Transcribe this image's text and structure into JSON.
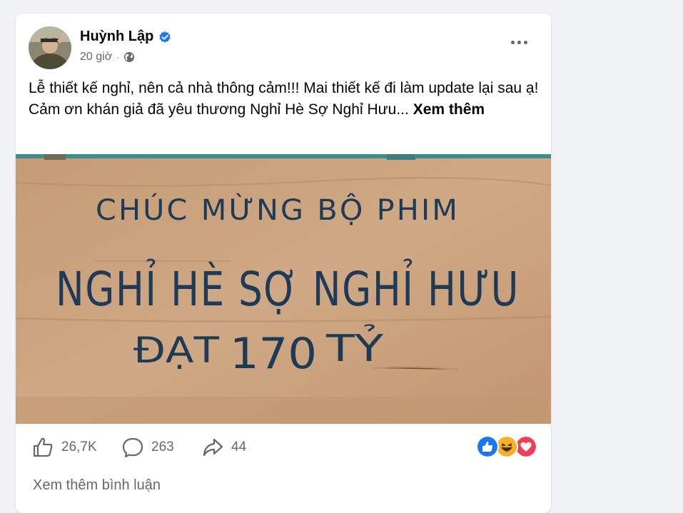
{
  "post": {
    "author": "Huỳnh Lập",
    "time": "20 giờ",
    "separator": "·",
    "text_line1": "Lễ thiết kế nghỉ, nên cả nhà thông cảm!!! Mai thiết kế đi làm update lại sau ạ!",
    "text_line2": "Cảm ơn khán giả đã yêu thương Nghỉ Hè Sợ Nghỉ Hưu...",
    "see_more": "Xem thêm"
  },
  "photo": {
    "line1": "CHÚC MỪNG BỘ PHIM",
    "line2": "NGHỈ HÈ SỢ NGHỈ HƯU",
    "line3_prefix": "ĐẠT",
    "line3_number": "170",
    "line3_suffix": "TỶ"
  },
  "stats": {
    "likes": "26,7K",
    "comments": "263",
    "shares": "44"
  },
  "footer": {
    "view_comments": "Xem thêm bình luận"
  },
  "icons": {
    "verified": "verified-badge-icon",
    "privacy": "globe-icon",
    "menu": "more-options-icon",
    "like": "thumbs-up-icon",
    "comment": "comment-bubble-icon",
    "share": "share-arrow-icon"
  },
  "colors": {
    "brand_blue": "#1877f2",
    "text_secondary": "#65676b",
    "cardboard": "#c9a27a",
    "marker": "#1e3a56",
    "love": "#f33e58",
    "haha": "#f7b125"
  }
}
